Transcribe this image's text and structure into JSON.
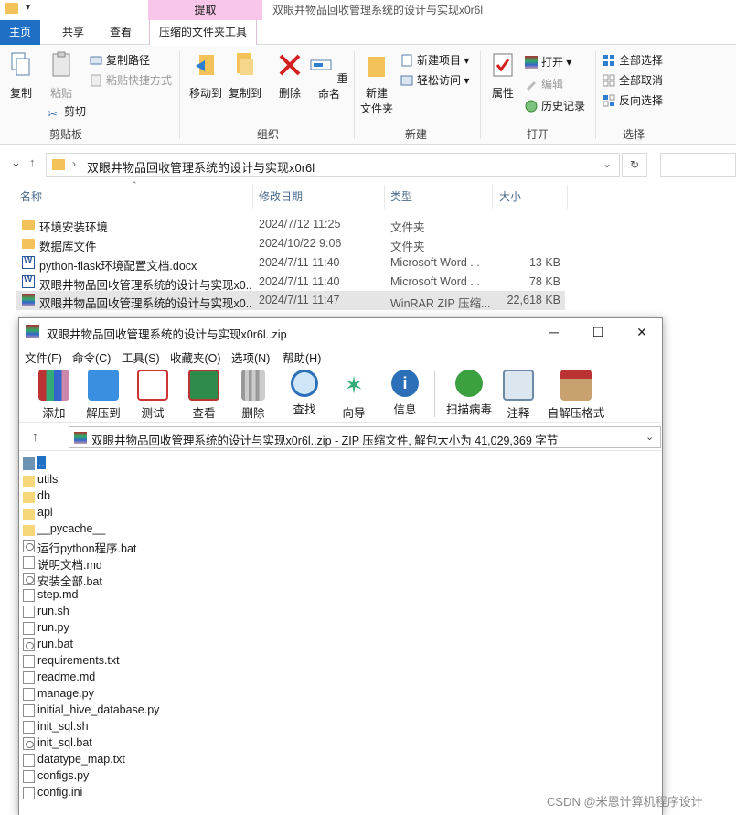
{
  "explorer": {
    "context_tab": "提取",
    "window_title": "双眼井物品回收管理系统的设计与实现x0r6l",
    "tabs": [
      "主页",
      "共享",
      "查看",
      "压缩的文件夹工具"
    ],
    "ribbon": {
      "clipboard": {
        "label": "剪贴板",
        "copy": "复制",
        "paste": "粘贴",
        "copy_path": "复制路径",
        "paste_shortcut": "粘贴快捷方式",
        "cut": "剪切"
      },
      "organize": {
        "label": "组织",
        "move_to": "移动到",
        "copy_to": "复制到",
        "delete": "删除",
        "rename": "重命名"
      },
      "new": {
        "label": "新建",
        "new_folder": "新建\n文件夹",
        "new_item": "新建项目",
        "easy_access": "轻松访问"
      },
      "open": {
        "label": "打开",
        "properties": "属性",
        "open": "打开",
        "edit": "编辑",
        "history": "历史记录"
      },
      "select": {
        "label": "选择",
        "select_all": "全部选择",
        "select_none": "全部取消",
        "invert": "反向选择"
      }
    },
    "address": "双眼井物品回收管理系统的设计与实现x0r6l",
    "columns": {
      "name": "名称",
      "date": "修改日期",
      "type": "类型",
      "size": "大小"
    },
    "files": [
      {
        "name": "环境安装环境",
        "date": "2024/7/12 11:25",
        "type": "文件夹",
        "size": "",
        "icon": "folder"
      },
      {
        "name": "数据库文件",
        "date": "2024/10/22 9:06",
        "type": "文件夹",
        "size": "",
        "icon": "folder"
      },
      {
        "name": "python-flask环境配置文档.docx",
        "date": "2024/7/11 11:40",
        "type": "Microsoft Word ...",
        "size": "13 KB",
        "icon": "word"
      },
      {
        "name": "双眼井物品回收管理系统的设计与实现x0...",
        "date": "2024/7/11 11:40",
        "type": "Microsoft Word ...",
        "size": "78 KB",
        "icon": "word"
      },
      {
        "name": "双眼井物品回收管理系统的设计与实现x0...",
        "date": "2024/7/11 11:47",
        "type": "WinRAR ZIP 压缩...",
        "size": "22,618 KB",
        "icon": "rar"
      }
    ]
  },
  "winrar": {
    "title": "双眼井物品回收管理系统的设计与实现x0r6l..zip",
    "menu": [
      "文件(F)",
      "命令(C)",
      "工具(S)",
      "收藏夹(O)",
      "选项(N)",
      "帮助(H)"
    ],
    "toolbar": [
      "添加",
      "解压到",
      "测试",
      "查看",
      "删除",
      "查找",
      "向导",
      "信息",
      "扫描病毒",
      "注释",
      "自解压格式"
    ],
    "path": "双眼井物品回收管理系统的设计与实现x0r6l..zip - ZIP 压缩文件, 解包大小为 41,029,369 字节",
    "items": [
      {
        "name": "..",
        "kind": "up"
      },
      {
        "name": "utils",
        "kind": "folder"
      },
      {
        "name": "db",
        "kind": "folder"
      },
      {
        "name": "api",
        "kind": "folder"
      },
      {
        "name": "__pycache__",
        "kind": "folder"
      },
      {
        "name": "运行python程序.bat",
        "kind": "bat"
      },
      {
        "name": "说明文档.md",
        "kind": "file"
      },
      {
        "name": "安装全部.bat",
        "kind": "bat"
      },
      {
        "name": "step.md",
        "kind": "file"
      },
      {
        "name": "run.sh",
        "kind": "file"
      },
      {
        "name": "run.py",
        "kind": "file"
      },
      {
        "name": "run.bat",
        "kind": "bat"
      },
      {
        "name": "requirements.txt",
        "kind": "file"
      },
      {
        "name": "readme.md",
        "kind": "file"
      },
      {
        "name": "manage.py",
        "kind": "file"
      },
      {
        "name": "initial_hive_database.py",
        "kind": "file"
      },
      {
        "name": "init_sql.sh",
        "kind": "file"
      },
      {
        "name": "init_sql.bat",
        "kind": "bat"
      },
      {
        "name": "datatype_map.txt",
        "kind": "file"
      },
      {
        "name": "configs.py",
        "kind": "file"
      },
      {
        "name": "config.ini",
        "kind": "file"
      }
    ]
  },
  "watermark": "CSDN @米恩计算机程序设计",
  "colors": {
    "accent": "#1f6fc4",
    "context_tab": "#f7c6e8",
    "folder": "#f3c35a",
    "selected_row": "#e5e5e5"
  }
}
